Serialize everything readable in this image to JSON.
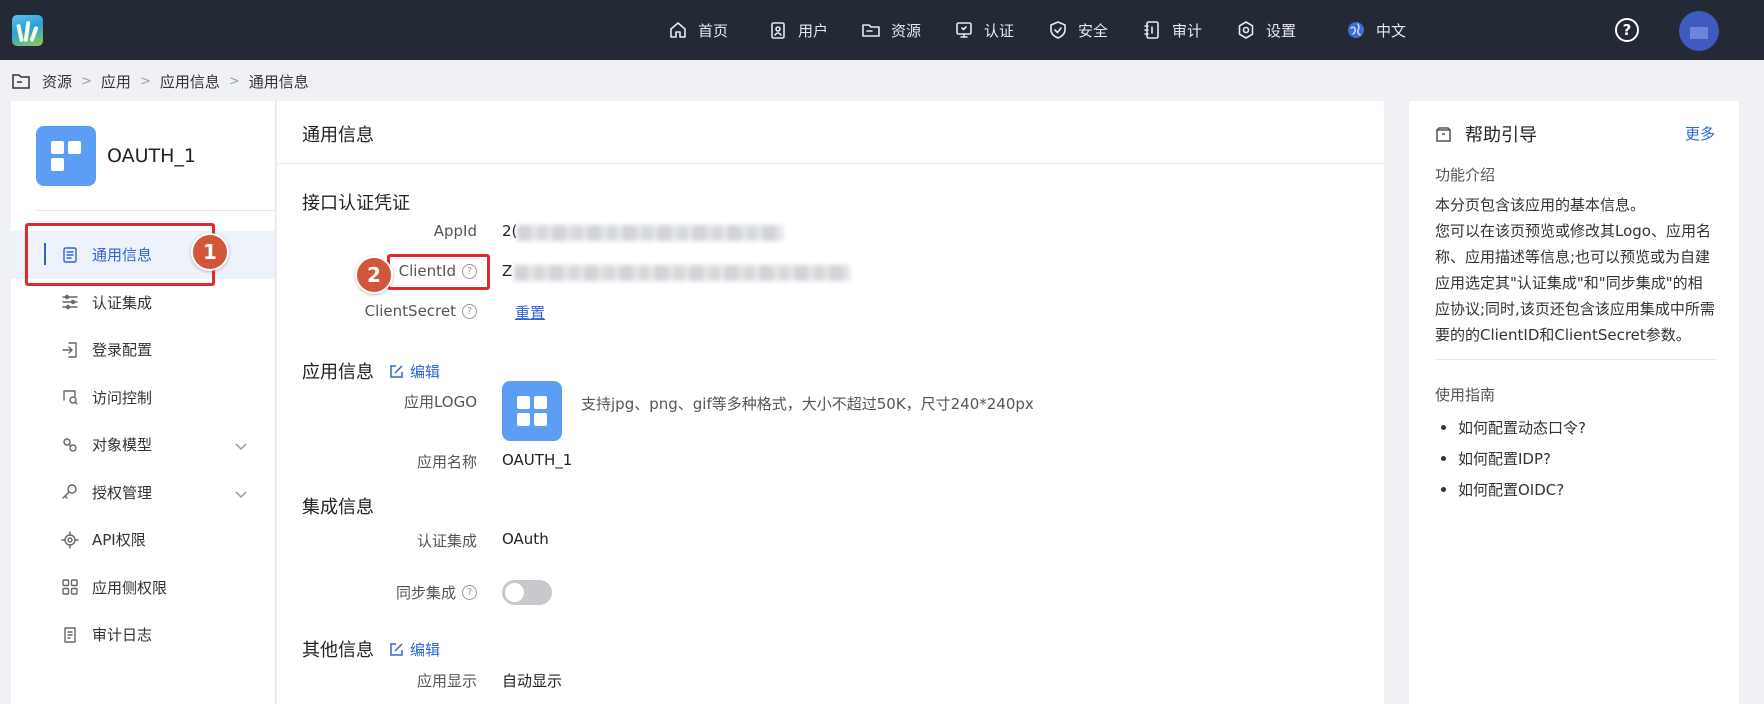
{
  "topbar": {
    "nav": [
      {
        "label": "首页",
        "icon": "home-icon"
      },
      {
        "label": "用户",
        "icon": "user-icon"
      },
      {
        "label": "资源",
        "icon": "folder-icon"
      },
      {
        "label": "认证",
        "icon": "monitor-icon"
      },
      {
        "label": "安全",
        "icon": "shield-icon"
      },
      {
        "label": "审计",
        "icon": "audit-icon"
      },
      {
        "label": "设置",
        "icon": "gear-icon"
      }
    ],
    "language": "中文",
    "help_symbol": "?"
  },
  "breadcrumb": [
    "资源",
    "应用",
    "应用信息",
    "通用信息"
  ],
  "sidebar": {
    "app_name": "OAUTH_1",
    "items": [
      {
        "label": "通用信息",
        "icon": "document-icon",
        "active": true
      },
      {
        "label": "认证集成",
        "icon": "sliders-icon"
      },
      {
        "label": "登录配置",
        "icon": "login-icon"
      },
      {
        "label": "访问控制",
        "icon": "access-icon"
      },
      {
        "label": "对象模型",
        "icon": "model-icon",
        "expandable": true
      },
      {
        "label": "授权管理",
        "icon": "key-icon",
        "expandable": true
      },
      {
        "label": "API权限",
        "icon": "chip-icon"
      },
      {
        "label": "应用侧权限",
        "icon": "grid-icon"
      },
      {
        "label": "审计日志",
        "icon": "log-icon"
      }
    ]
  },
  "annotations": {
    "badge1": "1",
    "badge2": "2"
  },
  "main": {
    "title": "通用信息",
    "credentials": {
      "title": "接口认证凭证",
      "appid_label": "AppId",
      "appid_prefix": "2(",
      "clientid_label": "ClientId",
      "clientid_prefix": "Z",
      "clientsecret_label": "ClientSecret",
      "reset_label": "重置"
    },
    "app_info": {
      "title": "应用信息",
      "edit_label": "编辑",
      "logo_label": "应用LOGO",
      "logo_hint": "支持jpg、png、gif等多种格式，大小不超过50K，尺寸240*240px",
      "name_label": "应用名称",
      "name_value": "OAUTH_1"
    },
    "integration": {
      "title": "集成信息",
      "auth_label": "认证集成",
      "auth_value": "OAuth",
      "sync_label": "同步集成",
      "sync_enabled": false
    },
    "other": {
      "title": "其他信息",
      "edit_label": "编辑",
      "display_label": "应用显示",
      "display_value": "自动显示"
    }
  },
  "help": {
    "title": "帮助引导",
    "more": "更多",
    "intro_title": "功能介绍",
    "intro_lines": [
      "本分页包含该应用的基本信息。",
      "您可以在该页预览或修改其Logo、应用名称、应用描述等信息;也可以预览或为自建应用选定其\"认证集成\"和\"同步集成\"的相应协议;同时,该页还包含该应用集成中所需要的的ClientID和ClientSecret参数。"
    ],
    "guide_title": "使用指南",
    "guides": [
      "如何配置动态口令?",
      "如何配置IDP?",
      "如何配置OIDC?"
    ]
  },
  "colors": {
    "topbar": "#242936",
    "accent": "#2e64d8",
    "annotation_red": "#e0292a",
    "badge": "#d2573a",
    "app_tile": "#5b9ef4"
  }
}
